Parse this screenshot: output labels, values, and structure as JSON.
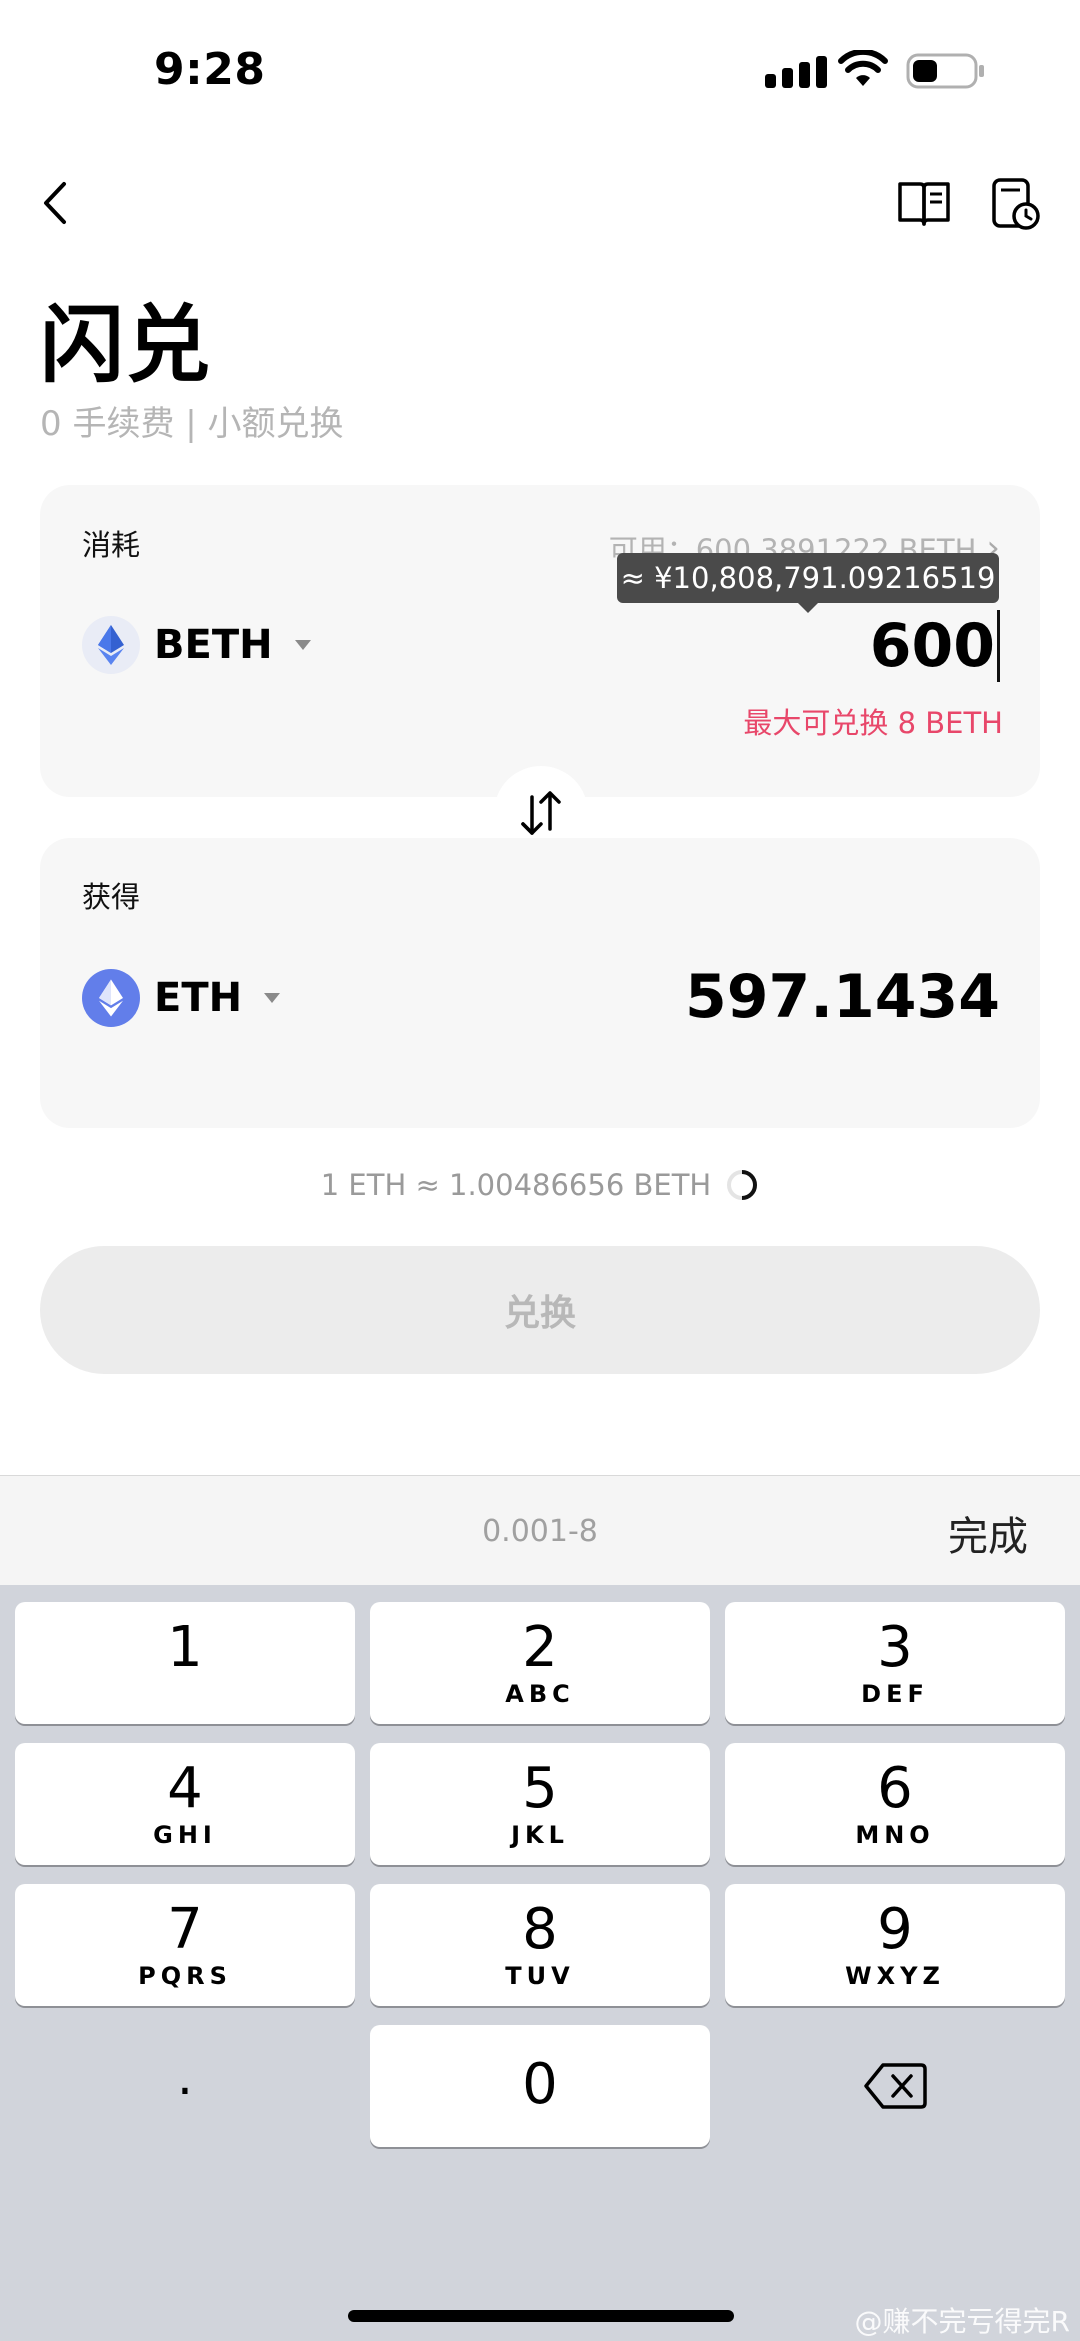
{
  "status_bar": {
    "time": "9:28"
  },
  "header": {
    "title": "闪兑",
    "subtitle": "0 手续费 | 小额兑换"
  },
  "spend": {
    "label": "消耗",
    "available": "可用：600.3891222 BETH",
    "coin": "BETH",
    "tooltip": "≈ ¥10,808,791.09216519",
    "amount": "600",
    "max_note": "最大可兑换 8 BETH"
  },
  "receive": {
    "label": "获得",
    "coin": "ETH",
    "amount": "597.1434"
  },
  "rate": "1 ETH ≈ 1.00486656 BETH",
  "exchange_button": "兑换",
  "keyboard": {
    "range_hint": "0.001-8",
    "done_label": "完成",
    "keys": [
      {
        "num": "1",
        "sub": ""
      },
      {
        "num": "2",
        "sub": "ABC"
      },
      {
        "num": "3",
        "sub": "DEF"
      },
      {
        "num": "4",
        "sub": "GHI"
      },
      {
        "num": "5",
        "sub": "JKL"
      },
      {
        "num": "6",
        "sub": "MNO"
      },
      {
        "num": "7",
        "sub": "PQRS"
      },
      {
        "num": "8",
        "sub": "TUV"
      },
      {
        "num": "9",
        "sub": "WXYZ"
      },
      {
        "num": ".",
        "sub": ""
      },
      {
        "num": "0",
        "sub": ""
      }
    ]
  },
  "watermark": "@赚不完亏得完R",
  "colors": {
    "accent_warning": "#e8476a",
    "eth_blue": "#627eea",
    "keyboard_bg": "#d1d4db"
  }
}
